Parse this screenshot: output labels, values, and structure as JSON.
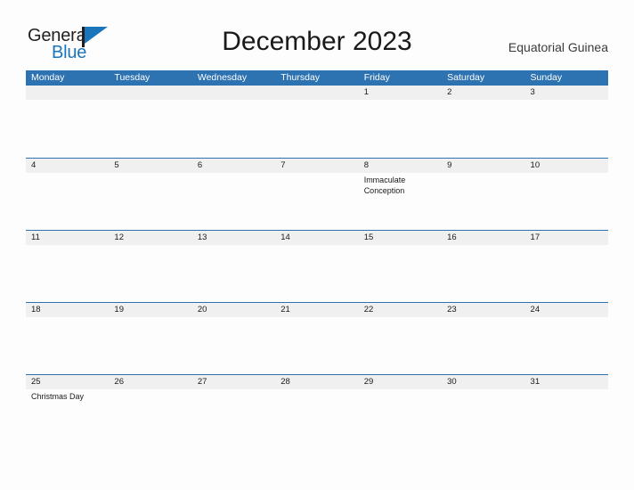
{
  "brand": {
    "name_part1": "General",
    "name_part2": "Blue",
    "flag_icon": "blue-triangle-flag-icon",
    "dark_color": "#231f20",
    "blue_color": "#1b75bb"
  },
  "header": {
    "title": "December 2023",
    "country": "Equatorial Guinea"
  },
  "theme": {
    "header_blue": "#2d72b1",
    "row_divider_blue": "#2d72b1",
    "date_band_gray": "#f0f0f0",
    "page_background": "#fdfdfd",
    "text_color": "#1a1a1a"
  },
  "calendar": {
    "month": "December",
    "year": "2023",
    "weekday_headers": [
      "Monday",
      "Tuesday",
      "Wednesday",
      "Thursday",
      "Friday",
      "Saturday",
      "Sunday"
    ],
    "weeks": [
      {
        "days": [
          {
            "date": "",
            "event": ""
          },
          {
            "date": "",
            "event": ""
          },
          {
            "date": "",
            "event": ""
          },
          {
            "date": "",
            "event": ""
          },
          {
            "date": "1",
            "event": ""
          },
          {
            "date": "2",
            "event": ""
          },
          {
            "date": "3",
            "event": ""
          }
        ]
      },
      {
        "days": [
          {
            "date": "4",
            "event": ""
          },
          {
            "date": "5",
            "event": ""
          },
          {
            "date": "6",
            "event": ""
          },
          {
            "date": "7",
            "event": ""
          },
          {
            "date": "8",
            "event": "Immaculate Conception"
          },
          {
            "date": "9",
            "event": ""
          },
          {
            "date": "10",
            "event": ""
          }
        ]
      },
      {
        "days": [
          {
            "date": "11",
            "event": ""
          },
          {
            "date": "12",
            "event": ""
          },
          {
            "date": "13",
            "event": ""
          },
          {
            "date": "14",
            "event": ""
          },
          {
            "date": "15",
            "event": ""
          },
          {
            "date": "16",
            "event": ""
          },
          {
            "date": "17",
            "event": ""
          }
        ]
      },
      {
        "days": [
          {
            "date": "18",
            "event": ""
          },
          {
            "date": "19",
            "event": ""
          },
          {
            "date": "20",
            "event": ""
          },
          {
            "date": "21",
            "event": ""
          },
          {
            "date": "22",
            "event": ""
          },
          {
            "date": "23",
            "event": ""
          },
          {
            "date": "24",
            "event": ""
          }
        ]
      },
      {
        "days": [
          {
            "date": "25",
            "event": "Christmas Day"
          },
          {
            "date": "26",
            "event": ""
          },
          {
            "date": "27",
            "event": ""
          },
          {
            "date": "28",
            "event": ""
          },
          {
            "date": "29",
            "event": ""
          },
          {
            "date": "30",
            "event": ""
          },
          {
            "date": "31",
            "event": ""
          }
        ]
      }
    ]
  }
}
